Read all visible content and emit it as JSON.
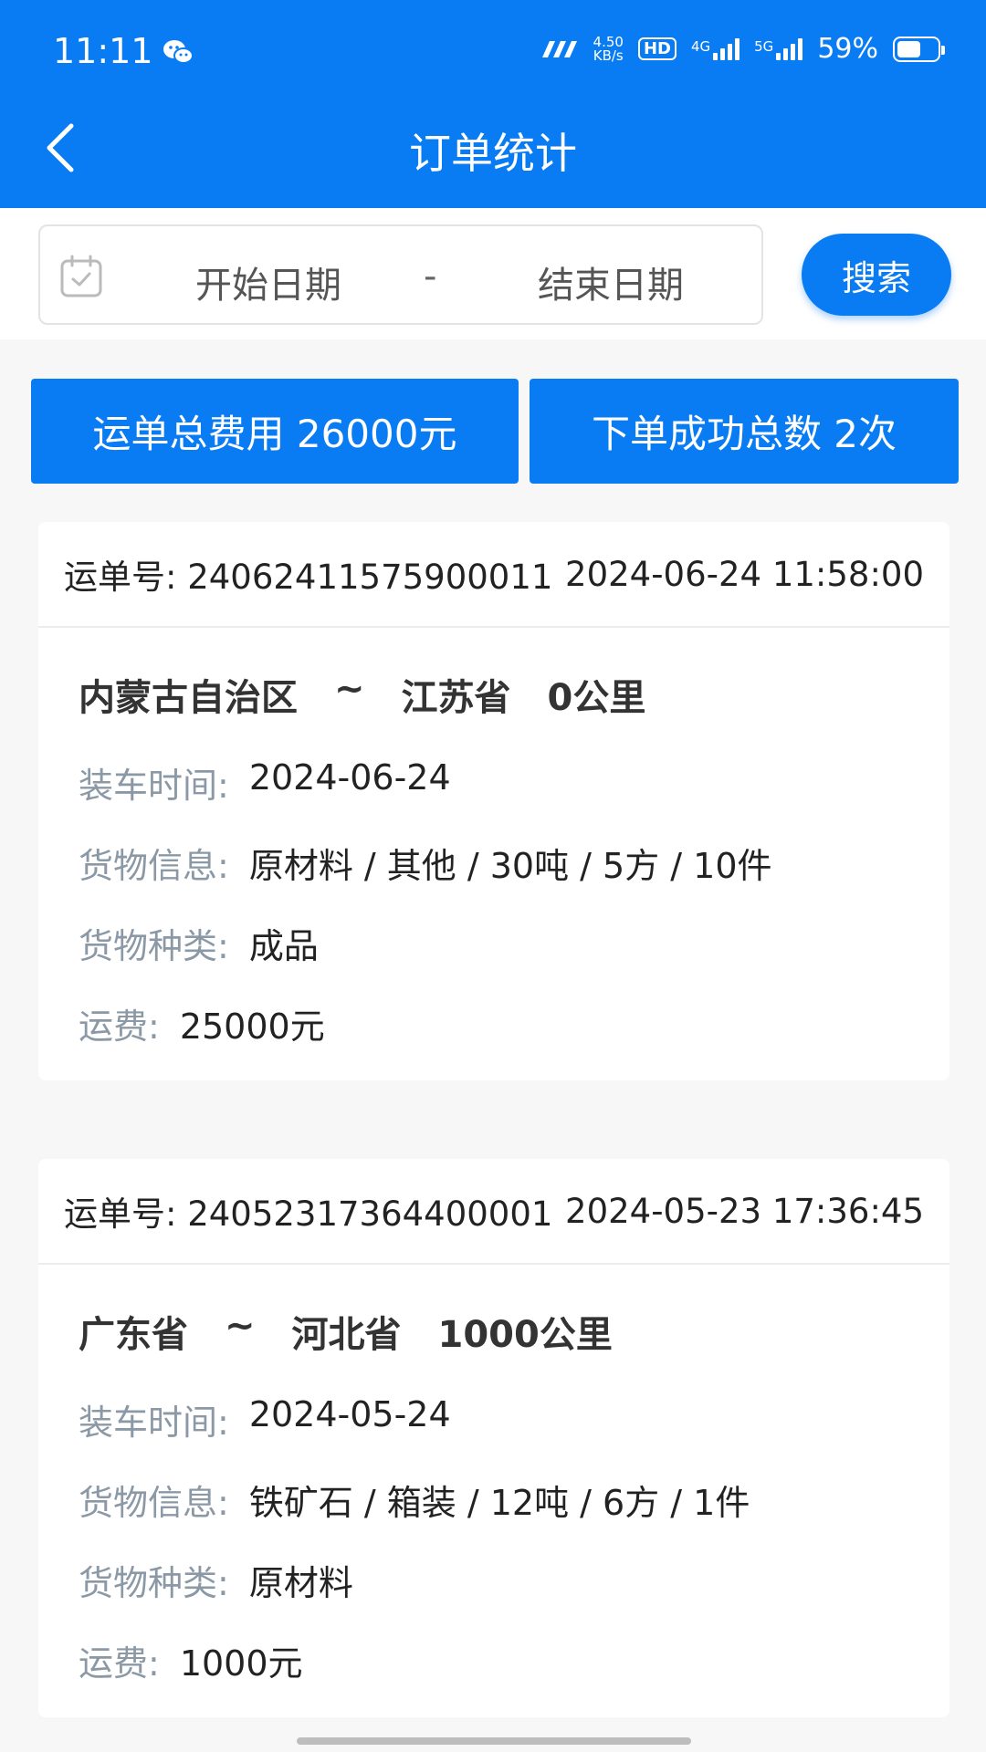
{
  "status_bar": {
    "time": "11:11",
    "speed_value": "4.50",
    "speed_unit": "KB/s",
    "hd_label": "HD",
    "net_4g": "4G",
    "net_5g": "5G",
    "battery": "59%"
  },
  "header": {
    "title": "订单统计"
  },
  "search": {
    "start_placeholder": "开始日期",
    "separator": "-",
    "end_placeholder": "结束日期",
    "button_label": "搜索"
  },
  "stats": {
    "total_fee": "运单总费用 26000元",
    "total_count": "下单成功总数 2次"
  },
  "orders": [
    {
      "waybill": "运单号: 24062411575900011",
      "datetime": "2024-06-24 11:58:00",
      "from": "内蒙古自治区",
      "tilde": "~",
      "to": "江苏省",
      "distance": "0公里",
      "load_label": "装车时间:",
      "load_time": "2024-06-24",
      "goods_label": "货物信息:",
      "goods_info": "原材料 / 其他 / 30吨 / 5方 / 10件",
      "type_label": "货物种类:",
      "goods_type": "成品",
      "fee_label": "运费:",
      "fee": "25000元"
    },
    {
      "waybill": "运单号: 24052317364400001",
      "datetime": "2024-05-23 17:36:45",
      "from": "广东省",
      "tilde": "~",
      "to": "河北省",
      "distance": "1000公里",
      "load_label": "装车时间:",
      "load_time": "2024-05-24",
      "goods_label": "货物信息:",
      "goods_info": "铁矿石 / 箱装 / 12吨 / 6方 / 1件",
      "type_label": "货物种类:",
      "goods_type": "原材料",
      "fee_label": "运费:",
      "fee": "1000元"
    }
  ],
  "colors": {
    "primary": "#0a7cf3",
    "label": "#8b99a6",
    "background": "#f7f7f7"
  }
}
